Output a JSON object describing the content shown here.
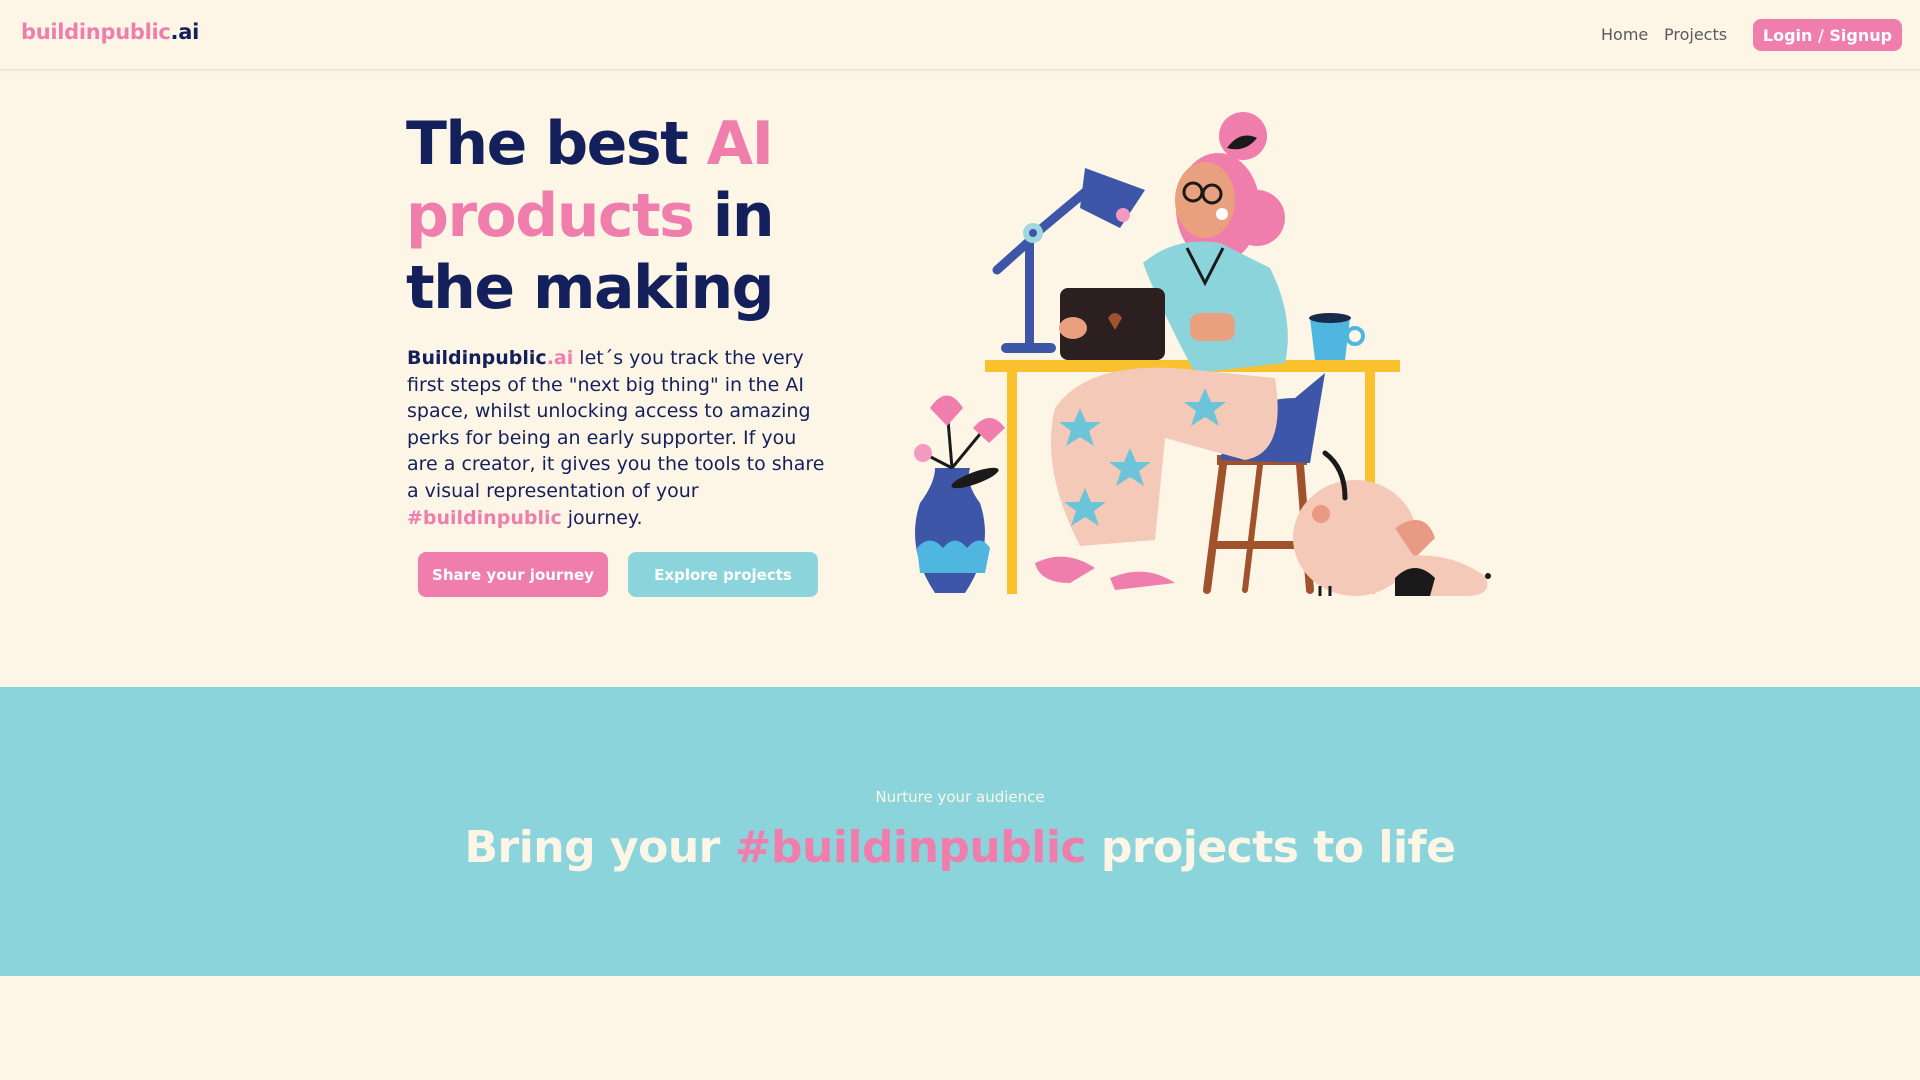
{
  "nav": {
    "logo_main": "buildinpublic",
    "logo_suffix": ".ai",
    "links": [
      "Home",
      "Projects"
    ],
    "login_label": "Login / Signup"
  },
  "hero": {
    "title_1": "The best ",
    "title_2": "AI",
    "title_3": "products",
    "title_4": " in",
    "title_5": "the making",
    "brand_name": "Buildinpublic",
    "brand_suffix": ".ai",
    "desc_main": " let´s you track the very first steps of the \"next big thing\" in the AI space, whilst unlocking access to amazing perks for being an early supporter. If you are a creator, it gives you the tools to share a visual representation of your ",
    "hashtag": "#buildinpublic",
    "desc_end": " journey.",
    "share_button": "Share your journey",
    "explore_button": "Explore projects"
  },
  "illustration": {
    "icon": "woman-at-desk-illustration"
  },
  "band": {
    "kicker": "Nurture your audience",
    "title_1": "Bring your ",
    "title_hashtag": "#buildinpublic",
    "title_2": " projects to life"
  },
  "colors": {
    "background": "#fdf6e7",
    "navy": "#13205c",
    "pink": "#f07eac",
    "teal": "#8bd4dc",
    "yellow": "#fbc02d"
  }
}
